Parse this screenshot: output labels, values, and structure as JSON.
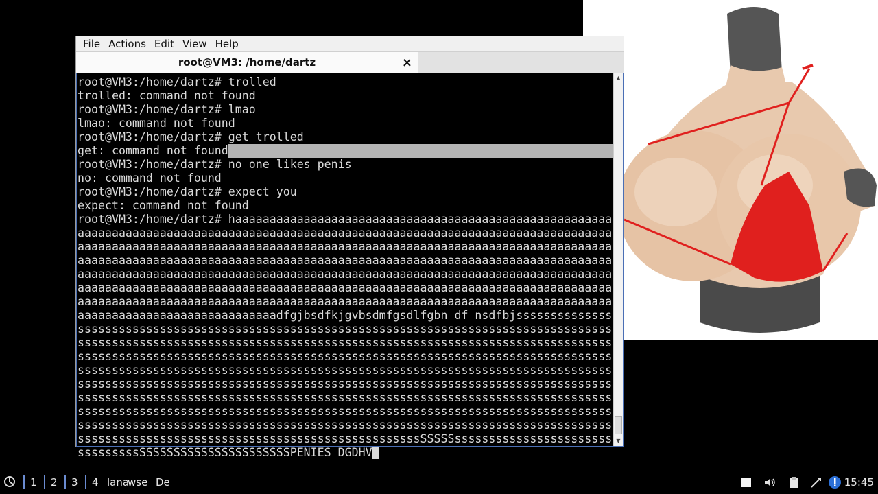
{
  "terminal": {
    "menu": [
      "File",
      "Actions",
      "Edit",
      "View",
      "Help"
    ],
    "tab_title": "root@VM3: /home/dartz",
    "close_icon": "×",
    "lines": [
      "root@VM3:/home/dartz# trolled",
      "trolled: command not found",
      "root@VM3:/home/dartz# lmao",
      "lmao: command not found",
      "root@VM3:/home/dartz# get trolled",
      "get: command not found",
      "root@VM3:/home/dartz# no one likes penis",
      "no: command not found",
      "root@VM3:/home/dartz# expect you",
      "expect: command not found",
      "root@VM3:/home/dartz# haaaaaaaaaaaaaaaaaaaaaaaaaaaaaaaaaaaaaaaaaaaaaaaaaaaaaaa",
      "aaaaaaaaaaaaaaaaaaaaaaaaaaaaaaaaaaaaaaaaaaaaaaaaaaaaaaaaaaaaaaaaaaaaaaaaaaaaaaaa",
      "aaaaaaaaaaaaaaaaaaaaaaaaaaaaaaaaaaaaaaaaaaaaaaaaaaaaaaaaaaaaaaaaaaaaaaaaaaaaaaaa",
      "aaaaaaaaaaaaaaaaaaaaaaaaaaaaaaaaaaaaaaaaaaaaaaaaaaaaaaaaaaaaaaaaaaaaaaaaaaaaaaaa",
      "aaaaaaaaaaaaaaaaaaaaaaaaaaaaaaaaaaaaaaaaaaaaaaaaaaaaaaaaaaaaaaaaaaaaaaaaaaaaaaaa",
      "aaaaaaaaaaaaaaaaaaaaaaaaaaaaaaaaaaaaaaaaaaaaaaaaaaaaaaaaaaaaaaaaaaaaaaaaaaaaaaaa",
      "aaaaaaaaaaaaaaaaaaaaaaaaaaaaaaaaaaaaaaaaaaaaaaaaaaaaaaaaaaaaaaaaaaaaaaaaaaaaaaaa",
      "aaaaaaaaaaaaaaaaaaaaaaaaaaaaadfgjbsdfkjgvbsdmfgsdlfgbn df nsdfbjsssssssssssssss",
      "ssssssssssssssssssssssssssssssssssssssssssssssssssssssssssssssssssssssssssssssss",
      "ssssssssssssssssssssssssssssssssssssssssssssssssssssssssssssssssssssssssssssssss",
      "ssssssssssssssssssssssssssssssssssssssssssssssssssssssssssssssssssssssssssssssss",
      "ssssssssssssssssssssssssssssssssssssssssssssssssssssssssssssssssssssssssssssssss",
      "ssssssssssssssssssssssssssssssssssssssssssssssssssssssssssssssssssssssssssssssss",
      "ssssssssssssssssssssssssssssssssssssssssssssssssssssssssssssssssssssssssssssssss",
      "ssssssssssssssssssssssssssssssssssssssssssssssssssssssssssssssssssssssssssssssss",
      "ssssssssssssssssssssssssssssssssssssssssssssssssssssssssssssssssssssssssssssssss",
      "ssssssssssssssssssssssssssssssssssssssssssssssssssSSSSSsssssssssssssssssssssssss",
      "sssssssssSSSSSSSSSSSSSSSSSSSSSSPENIES DGDHV"
    ]
  },
  "taskbar": {
    "workspaces": [
      "1",
      "2",
      "3",
      "4"
    ],
    "tasks": [
      "lana",
      "wse",
      "De"
    ],
    "clock": "15:45",
    "icons": [
      "start-menu-icon",
      "notes-icon",
      "volume-icon",
      "clipboard-icon",
      "network-icon",
      "update-notifier-icon"
    ]
  },
  "colors": {
    "terminal_bg": "#000000",
    "terminal_fg": "#d9d9d9",
    "selection": "#b4b4b4",
    "bikini_red": "#e0201e"
  }
}
